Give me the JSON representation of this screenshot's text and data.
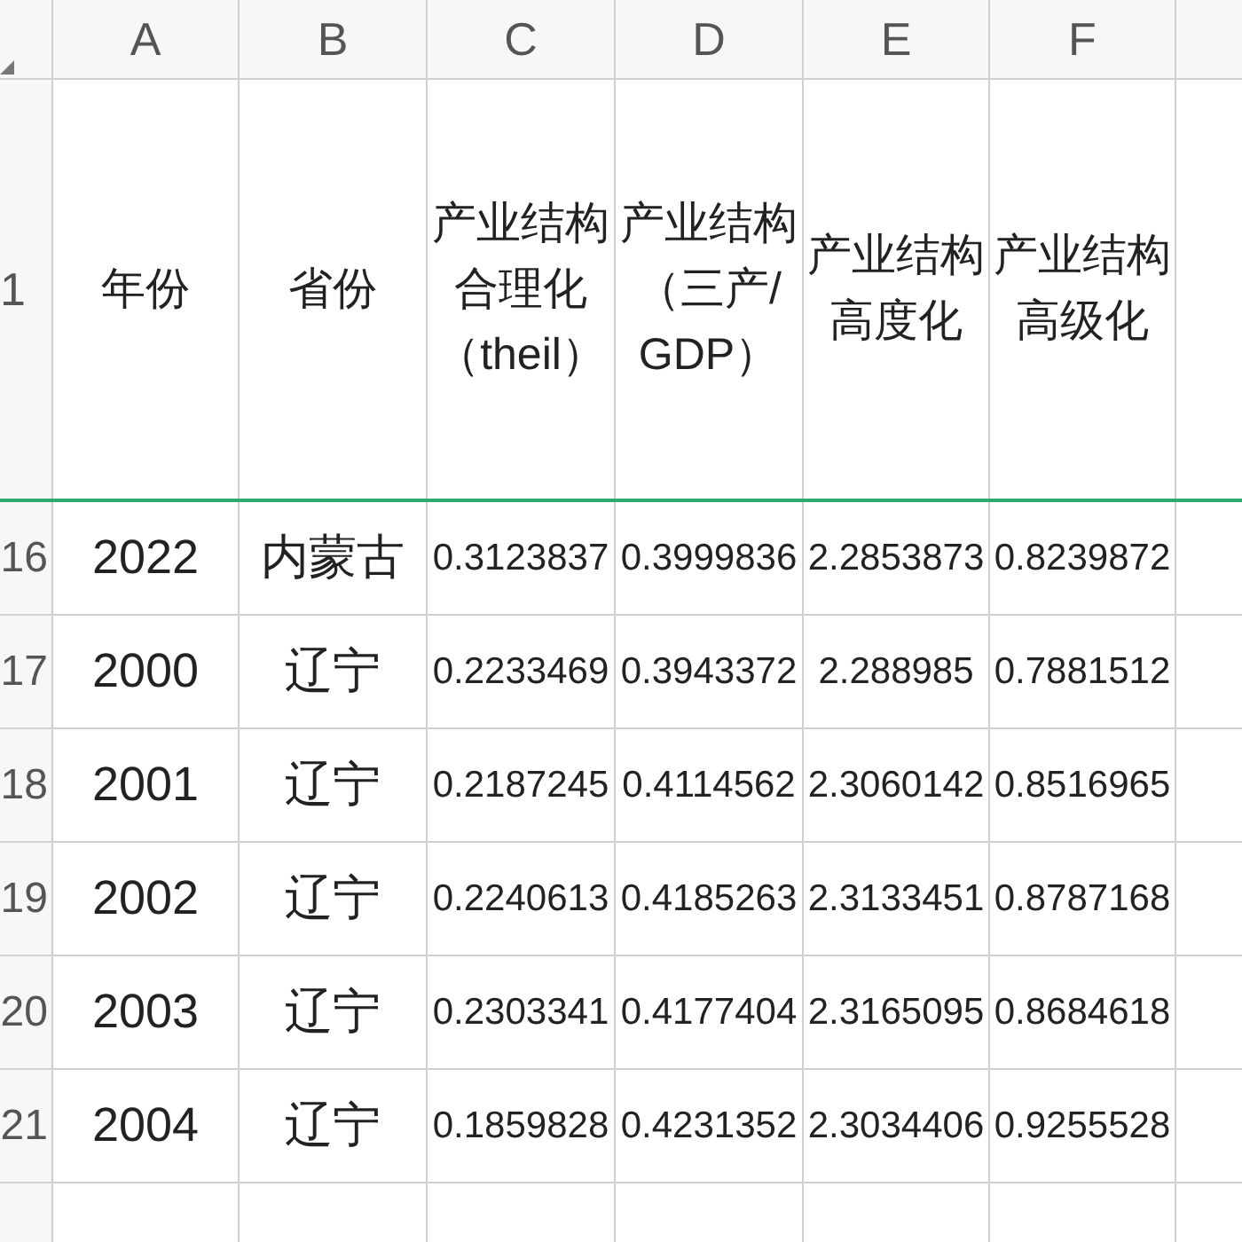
{
  "column_headers": [
    "A",
    "B",
    "C",
    "D",
    "E",
    "F"
  ],
  "header_row": {
    "number": "1",
    "cells": [
      "年份",
      "省份",
      "产业结构合理化（theil）",
      "产业结构（三产/GDP）",
      "产业结构高度化",
      "产业结构高级化"
    ]
  },
  "rows": [
    {
      "number": "16",
      "cells": [
        "2022",
        "内蒙古",
        "0.3123837",
        "0.3999836",
        "2.2853873",
        "0.8239872"
      ]
    },
    {
      "number": "17",
      "cells": [
        "2000",
        "辽宁",
        "0.2233469",
        "0.3943372",
        "2.288985",
        "0.7881512"
      ]
    },
    {
      "number": "18",
      "cells": [
        "2001",
        "辽宁",
        "0.2187245",
        "0.4114562",
        "2.3060142",
        "0.8516965"
      ]
    },
    {
      "number": "19",
      "cells": [
        "2002",
        "辽宁",
        "0.2240613",
        "0.4185263",
        "2.3133451",
        "0.8787168"
      ]
    },
    {
      "number": "20",
      "cells": [
        "2003",
        "辽宁",
        "0.2303341",
        "0.4177404",
        "2.3165095",
        "0.8684618"
      ]
    },
    {
      "number": "21",
      "cells": [
        "2004",
        "辽宁",
        "0.1859828",
        "0.4231352",
        "2.3034406",
        "0.9255528"
      ]
    }
  ]
}
